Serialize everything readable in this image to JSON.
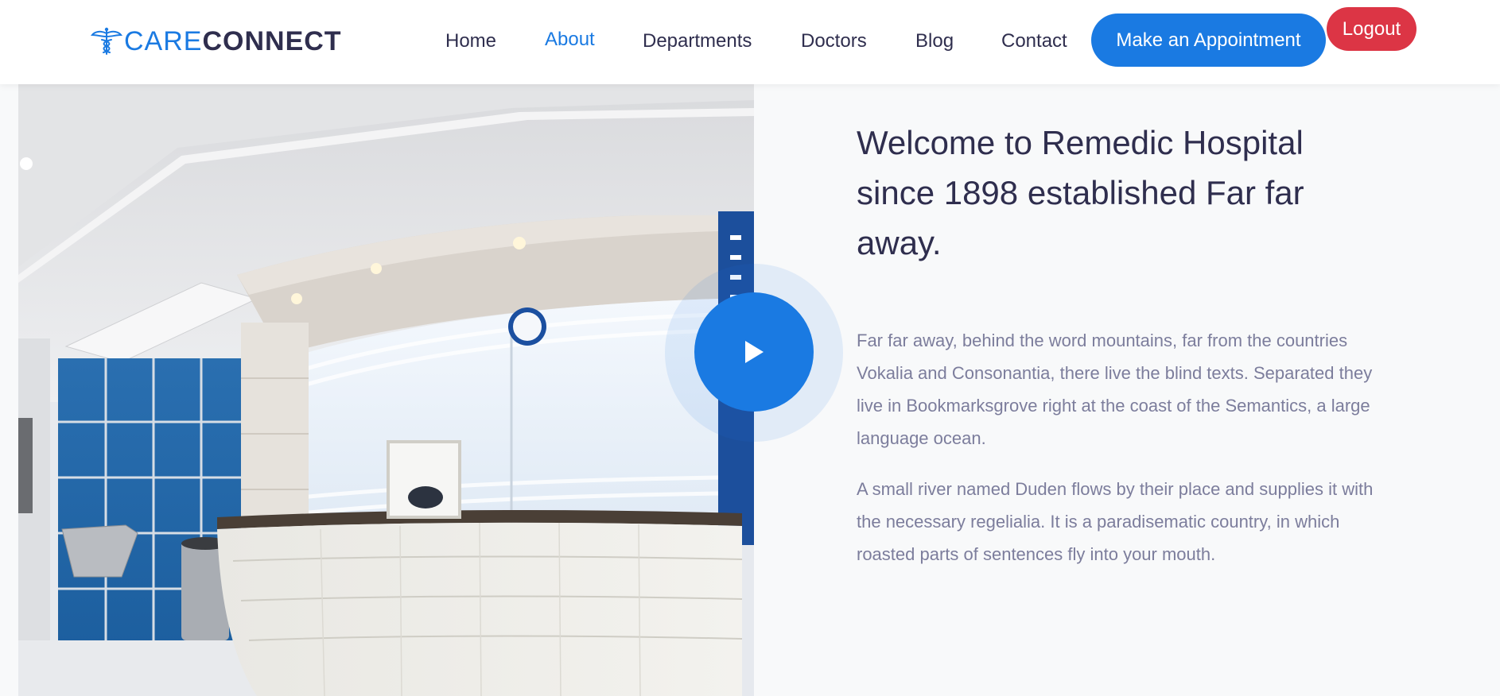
{
  "brand": {
    "part1": "CARE",
    "part2": "CONNECT",
    "icon": "caduceus-icon"
  },
  "nav": {
    "items": [
      {
        "label": "Home",
        "active": false
      },
      {
        "label": "About",
        "active": true
      },
      {
        "label": "Departments",
        "active": false
      },
      {
        "label": "Doctors",
        "active": false
      },
      {
        "label": "Blog",
        "active": false
      },
      {
        "label": "Contact",
        "active": false
      }
    ],
    "appointment_label": "Make an Appointment",
    "logout_label": "Logout"
  },
  "hero": {
    "image": "hospital-reception-photo",
    "play_icon": "play-icon"
  },
  "about": {
    "heading": "Welcome to Remedic Hospital since 1898 established Far far away.",
    "paragraph1": "Far far away, behind the word mountains, far from the countries Vokalia and Consonantia, there live the blind texts. Separated they live in Bookmarksgrove right at the coast of the Semantics, a large language ocean.",
    "paragraph2": "A small river named Duden flows by their place and supplies it with the necessary regelialia. It is a paradisematic country, in which roasted parts of sentences fly into your mouth."
  },
  "colors": {
    "primary": "#1a7ae2",
    "danger": "#dc3545",
    "heading": "#2f2e4e",
    "body_text": "#7c7d9c",
    "background": "#f8f9fa"
  }
}
